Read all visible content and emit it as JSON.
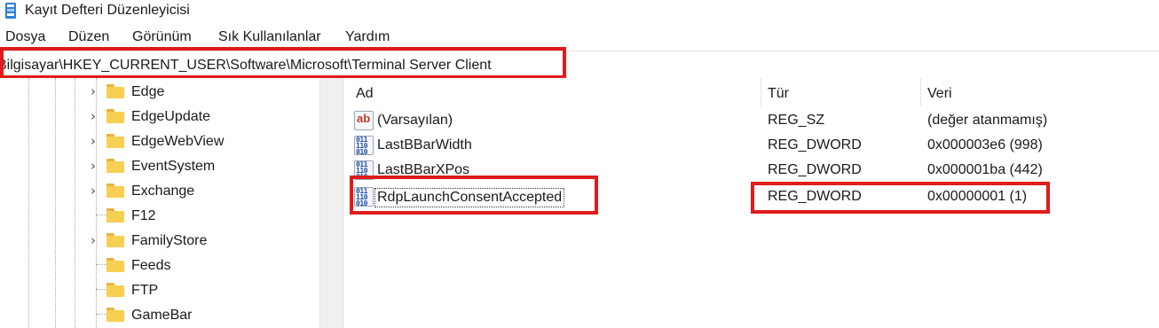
{
  "window": {
    "title": "Kayıt Defteri Düzenleyicisi",
    "app_icon": "regedit-icon"
  },
  "menu": [
    "Dosya",
    "Düzen",
    "Görünüm",
    "Sık Kullanılanlar",
    "Yardım"
  ],
  "address": {
    "path": "Bilgisayar\\HKEY_CURRENT_USER\\Software\\Microsoft\\Terminal Server Client"
  },
  "tree": {
    "items": [
      {
        "label": "Edge",
        "expandable": true
      },
      {
        "label": "EdgeUpdate",
        "expandable": true
      },
      {
        "label": "EdgeWebView",
        "expandable": true
      },
      {
        "label": "EventSystem",
        "expandable": true
      },
      {
        "label": "Exchange",
        "expandable": true
      },
      {
        "label": "F12",
        "expandable": false
      },
      {
        "label": "FamilyStore",
        "expandable": true
      },
      {
        "label": "Feeds",
        "expandable": false
      },
      {
        "label": "FTP",
        "expandable": false
      },
      {
        "label": "GameBar",
        "expandable": false
      }
    ]
  },
  "list": {
    "columns": {
      "name": "Ad",
      "type": "Tür",
      "data": "Veri"
    },
    "rows": [
      {
        "icon": "string-value-icon",
        "name": "(Varsayılan)",
        "type": "REG_SZ",
        "data": "(değer atanmamış)"
      },
      {
        "icon": "dword-value-icon",
        "name": "LastBBarWidth",
        "type": "REG_DWORD",
        "data": "0x000003e6 (998)"
      },
      {
        "icon": "dword-value-icon",
        "name": "LastBBarXPos",
        "type": "REG_DWORD",
        "data": "0x000001ba (442)"
      },
      {
        "icon": "dword-value-icon",
        "name": "RdpLaunchConsentAccepted",
        "type": "REG_DWORD",
        "data": "0x00000001 (1)"
      }
    ]
  },
  "colors": {
    "highlight": "#e01b1b",
    "folder": "#f7cf52"
  }
}
